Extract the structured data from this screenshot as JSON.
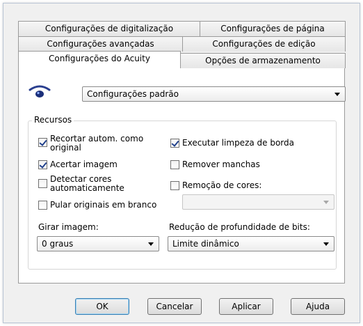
{
  "tabs": {
    "row1": [
      "Configurações de digitalização",
      "Configurações de página"
    ],
    "row2": [
      "Configurações avançadas",
      "Configurações de edição"
    ],
    "row3": [
      "Configurações do Acuity",
      "Opções de armazenamento"
    ]
  },
  "preset": {
    "value": "Configurações padrão"
  },
  "resources": {
    "title": "Recursos",
    "crop_line1": "Recortar autom. como",
    "crop_line2": "original",
    "straighten": "Acertar imagem",
    "detect_line1": "Detectar cores",
    "detect_line2": "automaticamente",
    "skip_blank": "Pular originais em branco",
    "edge_cleanup": "Executar limpeza de borda",
    "remove_spots": "Remover manchas",
    "color_removal": "Remoção de cores:",
    "color_removal_value": ""
  },
  "checked": {
    "crop": true,
    "straighten": true,
    "detect": false,
    "skip_blank": false,
    "edge_cleanup": true,
    "remove_spots": false,
    "color_removal": false
  },
  "rotate": {
    "label": "Girar imagem:",
    "value": "0 graus"
  },
  "bitdepth": {
    "label": "Redução de profundidade de bits:",
    "value": "Limite dinâmico"
  },
  "buttons": {
    "ok": "OK",
    "cancel": "Cancelar",
    "apply": "Aplicar",
    "help": "Ajuda"
  },
  "colors": {
    "eye": "#2a3f8f",
    "default_border": "#3c7fb1"
  }
}
